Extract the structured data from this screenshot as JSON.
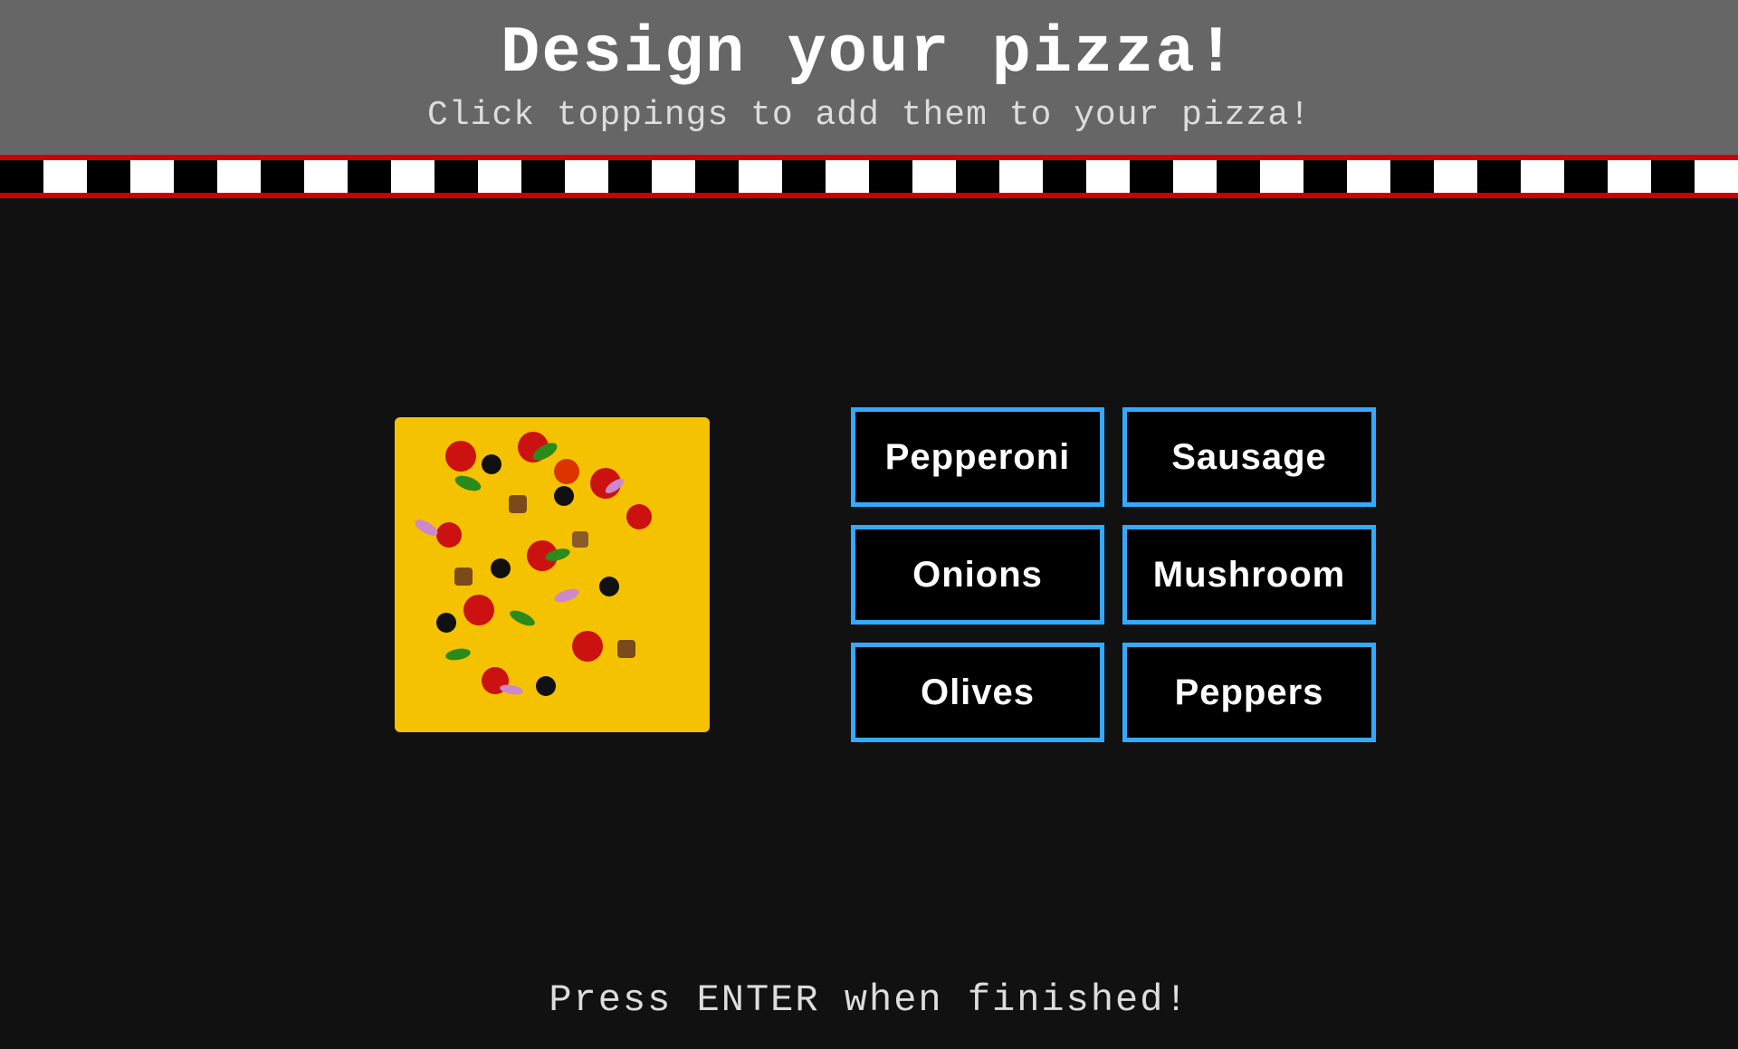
{
  "header": {
    "title": "Design your pizza!",
    "subtitle": "Click toppings to add them to your pizza!"
  },
  "toppings": [
    {
      "id": "pepperoni",
      "label": "Pepperoni"
    },
    {
      "id": "sausage",
      "label": "Sausage"
    },
    {
      "id": "onions",
      "label": "Onions"
    },
    {
      "id": "mushroom",
      "label": "Mushroom"
    },
    {
      "id": "olives",
      "label": "Olives"
    },
    {
      "id": "peppers",
      "label": "Peppers"
    }
  ],
  "footer": {
    "text": "Press ENTER when finished!"
  },
  "colors": {
    "header_bg": "#666666",
    "main_bg": "#111111",
    "border_top": "#cc0000",
    "checker_dark": "#000000",
    "checker_light": "#ffffff",
    "button_border": "#33aaff",
    "button_bg": "#000000",
    "button_text": "#ffffff",
    "pizza_yellow": "#f5c200",
    "pizza_crust": "#c87800"
  }
}
